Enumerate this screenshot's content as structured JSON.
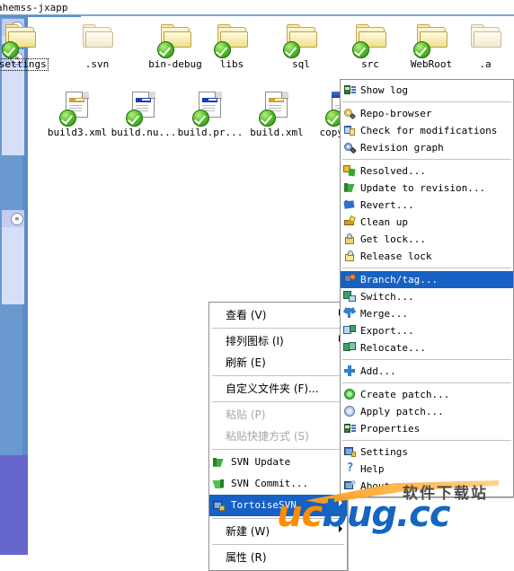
{
  "window": {
    "title": "ahemss-jxapp"
  },
  "left_pane": {
    "panels": [
      {
        "name": "collapse-panel-1",
        "chevron": "»"
      },
      {
        "name": "collapse-panel-2",
        "chevron": "«"
      },
      {
        "name": "collapse-panel-3",
        "chevron": "«"
      }
    ]
  },
  "files": {
    "folders": [
      {
        "label": ".settings",
        "kind": "folder",
        "svn": true,
        "selected": true
      },
      {
        "label": ".svn",
        "kind": "folder",
        "svn": false,
        "selected": false
      },
      {
        "label": "bin-debug",
        "kind": "folder",
        "svn": true,
        "selected": false
      },
      {
        "label": "libs",
        "kind": "folder",
        "svn": true,
        "selected": false
      },
      {
        "label": "sql",
        "kind": "folder",
        "svn": true,
        "selected": false
      },
      {
        "label": "src",
        "kind": "folder",
        "svn": true,
        "selected": false
      },
      {
        "label": "WebRoot",
        "kind": "folder",
        "svn": true,
        "selected": false
      },
      {
        "label": ".a",
        "kind": "folder",
        "svn": false,
        "selected": false
      }
    ],
    "documents": [
      {
        "label": "build3.xml",
        "kind": "xml-gold",
        "svn": true
      },
      {
        "label": "build.nu...",
        "kind": "xml-blue",
        "svn": true
      },
      {
        "label": "build.pr...",
        "kind": "xml-blue",
        "svn": true
      },
      {
        "label": "build.xml",
        "kind": "xml-gold",
        "svn": true
      },
      {
        "label": "copyswf.",
        "kind": "window",
        "svn": true
      }
    ]
  },
  "context_menu": {
    "name": "folder-background-context-menu",
    "items": [
      {
        "label": "查看 (V)",
        "icon": "none",
        "submenu": true,
        "disabled": false,
        "highlight": false,
        "sep_after": true
      },
      {
        "label": "排列图标 (I)",
        "icon": "none",
        "submenu": true,
        "disabled": false,
        "highlight": false,
        "sep_after": false
      },
      {
        "label": "刷新 (E)",
        "icon": "none",
        "submenu": false,
        "disabled": false,
        "highlight": false,
        "sep_after": true
      },
      {
        "label": "自定义文件夹 (F)...",
        "icon": "none",
        "submenu": false,
        "disabled": false,
        "highlight": false,
        "sep_after": true
      },
      {
        "label": "粘贴 (P)",
        "icon": "none",
        "submenu": false,
        "disabled": true,
        "highlight": false,
        "sep_after": false
      },
      {
        "label": "粘贴快捷方式 (S)",
        "icon": "none",
        "submenu": false,
        "disabled": true,
        "highlight": false,
        "sep_after": true
      },
      {
        "label": "SVN Update",
        "icon": "svn-update-icon",
        "submenu": false,
        "disabled": false,
        "highlight": false,
        "sep_after": false
      },
      {
        "label": "SVN Commit...",
        "icon": "svn-commit-icon",
        "submenu": false,
        "disabled": false,
        "highlight": false,
        "sep_after": false
      },
      {
        "label": "TortoiseSVN",
        "icon": "tortoise-icon",
        "submenu": true,
        "disabled": false,
        "highlight": true,
        "sep_after": true
      },
      {
        "label": "新建 (W)",
        "icon": "none",
        "submenu": true,
        "disabled": false,
        "highlight": false,
        "sep_after": true
      },
      {
        "label": "属性 (R)",
        "icon": "none",
        "submenu": false,
        "disabled": false,
        "highlight": false,
        "sep_after": false
      }
    ]
  },
  "tortoise_submenu": {
    "name": "tortoisesvn-submenu",
    "items": [
      {
        "label": "Show log",
        "icon": "show-log-icon",
        "highlight": false,
        "sep_after": true
      },
      {
        "label": "Repo-browser",
        "icon": "repo-browser-icon",
        "highlight": false,
        "sep_after": false
      },
      {
        "label": "Check for modifications",
        "icon": "check-mods-icon",
        "highlight": false,
        "sep_after": false
      },
      {
        "label": "Revision graph",
        "icon": "revision-graph-icon",
        "highlight": false,
        "sep_after": true
      },
      {
        "label": "Resolved...",
        "icon": "resolved-icon",
        "highlight": false,
        "sep_after": false
      },
      {
        "label": "Update to revision...",
        "icon": "update-revision-icon",
        "highlight": false,
        "sep_after": false
      },
      {
        "label": "Revert...",
        "icon": "revert-icon",
        "highlight": false,
        "sep_after": false
      },
      {
        "label": "Clean up",
        "icon": "cleanup-icon",
        "highlight": false,
        "sep_after": false
      },
      {
        "label": "Get lock...",
        "icon": "get-lock-icon",
        "highlight": false,
        "sep_after": false
      },
      {
        "label": "Release lock",
        "icon": "release-lock-icon",
        "highlight": false,
        "sep_after": true
      },
      {
        "label": "Branch/tag...",
        "icon": "branch-tag-icon",
        "highlight": true,
        "sep_after": false
      },
      {
        "label": "Switch...",
        "icon": "switch-icon",
        "highlight": false,
        "sep_after": false
      },
      {
        "label": "Merge...",
        "icon": "merge-icon",
        "highlight": false,
        "sep_after": false
      },
      {
        "label": "Export...",
        "icon": "export-icon",
        "highlight": false,
        "sep_after": false
      },
      {
        "label": "Relocate...",
        "icon": "relocate-icon",
        "highlight": false,
        "sep_after": true
      },
      {
        "label": "Add...",
        "icon": "add-icon",
        "highlight": false,
        "sep_after": true
      },
      {
        "label": "Create patch...",
        "icon": "create-patch-icon",
        "highlight": false,
        "sep_after": false
      },
      {
        "label": "Apply patch...",
        "icon": "apply-patch-icon",
        "highlight": false,
        "sep_after": false
      },
      {
        "label": "Properties",
        "icon": "properties-icon",
        "highlight": false,
        "sep_after": true
      },
      {
        "label": "Settings",
        "icon": "settings-icon",
        "highlight": false,
        "sep_after": false
      },
      {
        "label": "Help",
        "icon": "help-icon",
        "highlight": false,
        "sep_after": false
      },
      {
        "label": "About",
        "icon": "about-icon",
        "highlight": false,
        "sep_after": false
      }
    ]
  },
  "watermark": {
    "chinese": "软件下载站",
    "brand_u": "u",
    "brand_c": "c",
    "brand_bug": "bug",
    "brand_tld": ".cc"
  },
  "colors": {
    "menu_highlight": "#1761c4",
    "task_pane_blue": "#6a99d0",
    "task_panel_fill": "#d6dff7",
    "svn_green": "#56c22a",
    "brand_orange": "#ff8c00",
    "brand_blue": "#1466c0"
  }
}
